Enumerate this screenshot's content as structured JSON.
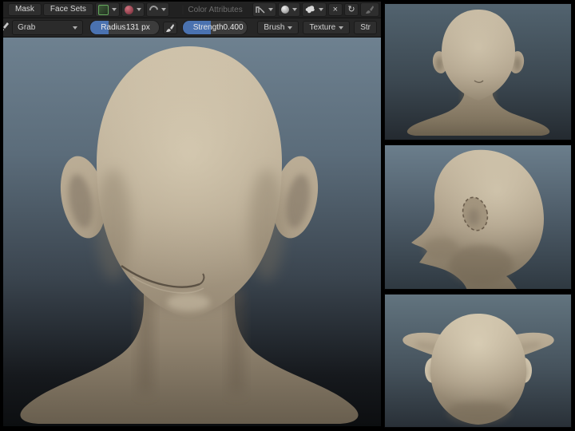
{
  "toolbar_menus": {
    "mask": "Mask",
    "face_sets": "Face Sets",
    "color_attributes": "Color Attributes"
  },
  "tool_settings": {
    "active_tool": "Grab",
    "radius": {
      "label": "Radius",
      "value": "131 px",
      "fill_pct": 27
    },
    "strength": {
      "label": "Strength",
      "value": "0.400",
      "fill_pct": 44
    },
    "brush_menu": "Brush",
    "texture_menu": "Texture",
    "stroke_menu": "Str"
  },
  "glyphs": {
    "mirror_x": "×",
    "recycle": "↻"
  },
  "colors": {
    "slider_accent": "#4a72b0",
    "header_bg": "#222222",
    "button_bg": "#2e2e2e",
    "viewport_top": "#6e8190",
    "viewport_bottom": "#0c0e10",
    "skin": "#b2a48d",
    "frame": "#000000"
  }
}
